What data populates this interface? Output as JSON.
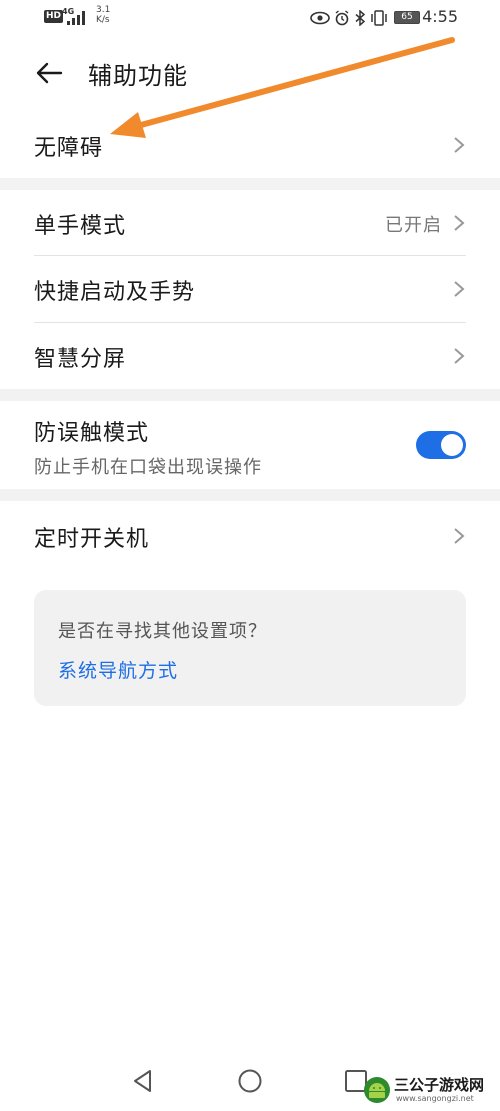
{
  "status_bar": {
    "hd": "HD",
    "network": "4G",
    "speed_value": "3.1",
    "speed_unit": "K/s",
    "battery": "65",
    "time": "4:55",
    "icons": [
      "eye-icon",
      "alarm-icon",
      "bluetooth-icon",
      "vibrate-icon"
    ]
  },
  "header": {
    "title": "辅助功能"
  },
  "settings": {
    "accessibility": "无障碍",
    "one_hand_mode": "单手模式",
    "one_hand_mode_value": "已开启",
    "quick_launch": "快捷启动及手势",
    "smart_split": "智慧分屏",
    "anti_touch": "防误触模式",
    "anti_touch_desc": "防止手机在口袋出现误操作",
    "anti_touch_enabled": true,
    "scheduled_power": "定时开关机"
  },
  "suggestion": {
    "question": "是否在寻找其他设置项？",
    "link": "系统导航方式"
  },
  "nav": {
    "icons": [
      "back-triangle-icon",
      "home-circle-icon",
      "recent-square-icon"
    ]
  },
  "watermark": {
    "title": "三公子游戏网",
    "url": "www.sangongzi.net"
  },
  "colors": {
    "accent": "#1e6ee6",
    "annotation_arrow": "#f08a2c",
    "section_gap": "#f2f2f2"
  }
}
